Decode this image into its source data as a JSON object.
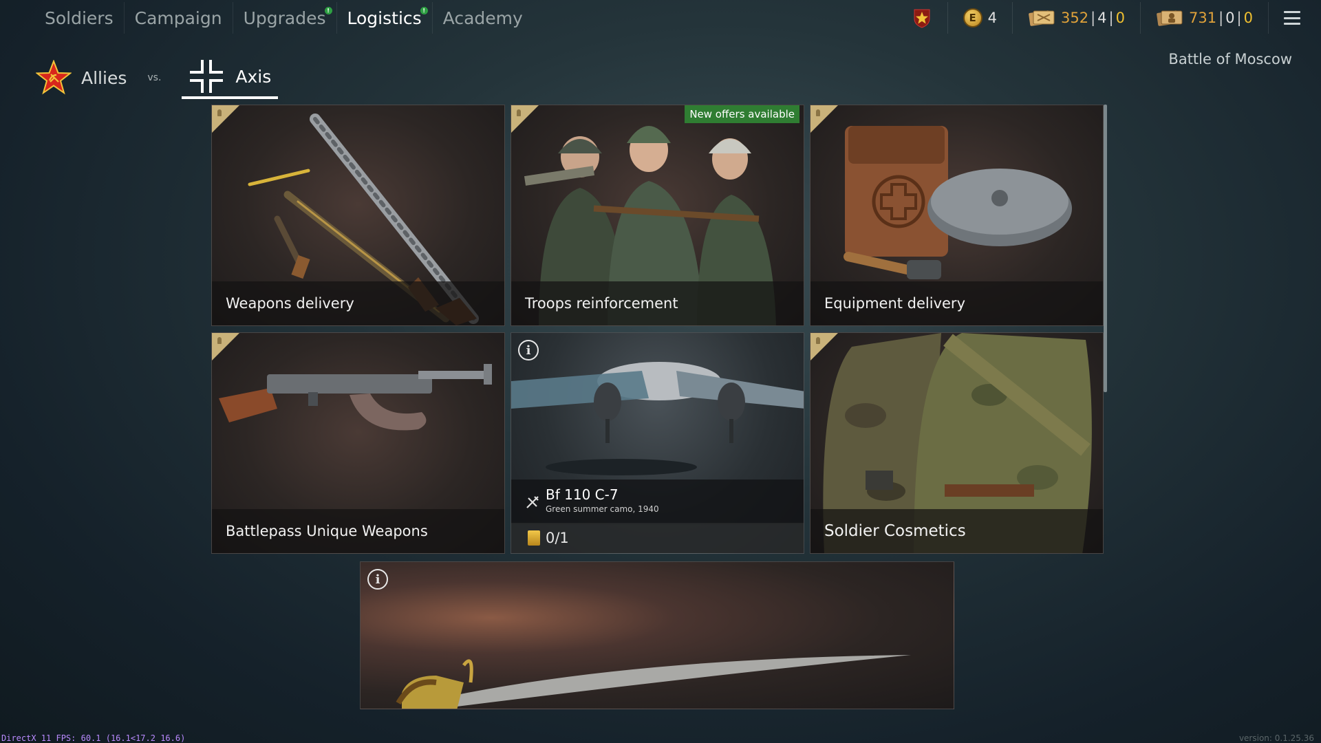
{
  "nav": {
    "tabs": [
      {
        "label": "Soldiers",
        "active": false,
        "notify": false
      },
      {
        "label": "Campaign",
        "active": false,
        "notify": false
      },
      {
        "label": "Upgrades",
        "active": false,
        "notify": true
      },
      {
        "label": "Logistics",
        "active": true,
        "notify": true
      },
      {
        "label": "Academy",
        "active": false,
        "notify": false
      }
    ],
    "notify_glyph": "!"
  },
  "currency": {
    "rank_icon": "star-shield-icon",
    "gold": "4",
    "gold_glyph": "E",
    "orders1": {
      "main": "352",
      "b": "4",
      "c": "0"
    },
    "orders2": {
      "main": "731",
      "b": "0",
      "c": "0"
    },
    "menu_icon": "list-menu-icon"
  },
  "factions": {
    "allies": "Allies",
    "vs": "vs.",
    "axis": "Axis",
    "selected": "Axis"
  },
  "campaign_title": "Battle of Moscow",
  "cards": {
    "weapons": {
      "label": "Weapons delivery"
    },
    "troops": {
      "label": "Troops reinforcement",
      "badge": "New offers available"
    },
    "equipment": {
      "label": "Equipment delivery"
    },
    "battlepass": {
      "label": "Battlepass Unique Weapons"
    },
    "plane": {
      "name": "Bf 110 C-7",
      "subtitle": "Green summer camo, 1940",
      "count": "0/1",
      "info_glyph": "i"
    },
    "cosmetics": {
      "label": "Soldier Cosmetics"
    },
    "saber": {
      "info_glyph": "i"
    }
  },
  "footer": {
    "fps": "DirectX 11 FPS: 60.1 (16.1<17.2 16.6)",
    "version": "version: 0.1.25.36"
  },
  "colors": {
    "accent_green": "#2ea043",
    "gold": "#f0c030",
    "orange": "#e0a23a"
  }
}
